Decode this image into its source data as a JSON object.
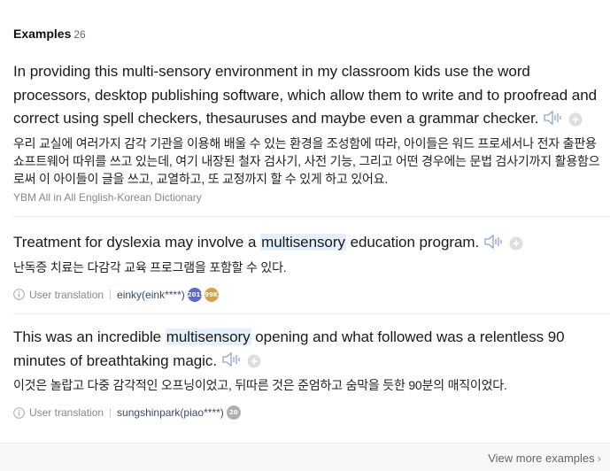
{
  "header": {
    "title": "Examples",
    "count": "26"
  },
  "examples": [
    {
      "en_parts": [
        "In providing this multi-sensory environment in my classroom kids use the word processors, desktop publishing software, which allow them to write and to proofread and correct using spell checkers, thesauruses and maybe even a grammar checker."
      ],
      "ko": "우리 교실에 여러가지 감각 기관을 이용해 배울 수 있는 환경을 조성함에 따라, 아이들은 워드 프로세서나 전자 출판용 쇼프트웨어 따위를 쓰고 있는데, 여기 내장된 철자 검사기, 사전 기능, 그리고 어떤 경우에는 문법 검사기까지 활용함으로써 이 아이들이 글을 쓰고, 교열하고, 또 교정까지 할 수 있게 하고 있어요.",
      "source": "YBM All in All English-Korean Dictionary"
    },
    {
      "en_before": "Treatment for dyslexia may involve a ",
      "en_highlight": "multisensory",
      "en_after": " education program.",
      "ko": "난독증 치료는 다감각 교육 프로그램을 포함할 수 있다.",
      "meta_label": "User translation",
      "user": "einky(eink****)",
      "badges": [
        {
          "text": "2019",
          "color": "#5b6ad0"
        },
        {
          "text": "99K",
          "color": "#d7a146"
        }
      ]
    },
    {
      "en_before": "This was an incredible ",
      "en_highlight": "multisensory",
      "en_after": " opening and what followed was a relentless 90 minutes of breathtaking magic.",
      "ko": "이것은 놀랍고 다중 감각적인 오프닝이었고, 뒤따른 것은 준엄하고 숨막을 듯한 90분의 매직이었다.",
      "meta_label": "User translation",
      "user": "sungshinpark(piao****)",
      "badges": [
        {
          "text": "20",
          "color": "#b0b0b0"
        }
      ]
    }
  ],
  "footer": {
    "view_more": "View more examples",
    "chevron": "›"
  },
  "icons": {
    "speaker": "speaker-icon",
    "plus": "plus-icon",
    "info": "info-icon"
  },
  "colors": {
    "highlight": "#e6f0fb",
    "icon": "#8aa4c8"
  }
}
